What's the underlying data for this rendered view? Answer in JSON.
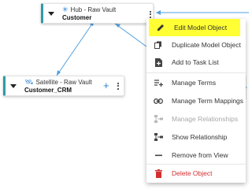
{
  "colors": {
    "accent": "#2f9aa7",
    "link_line": "#4f9fe0",
    "highlight": "#ffff33",
    "danger": "#d32f2f",
    "disabled": "#a8a8a8"
  },
  "hub_node": {
    "type_label": "Hub - Raw Vault",
    "type_icon": "hub-asterisk-icon",
    "name": "Customer"
  },
  "satellite_node": {
    "type_label": "Satellite - Raw Vault",
    "type_icon": "satellite-icon",
    "name": "Customer_CRM",
    "add_symbol": "+"
  },
  "context_menu": {
    "items": [
      {
        "label": "Edit Model Object",
        "icon": "pencil-icon",
        "state": "highlighted"
      },
      {
        "label": "Duplicate Model Object",
        "icon": "copy-icon",
        "state": "normal"
      },
      {
        "label": "Add to Task List",
        "icon": "add-file-icon",
        "state": "normal"
      },
      {
        "label": "Manage Terms",
        "icon": "playlist-add-icon",
        "state": "normal"
      },
      {
        "label": "Manage Term Mappings",
        "icon": "link-icon",
        "state": "normal"
      },
      {
        "label": "Manage Relationships",
        "icon": "relationships-icon",
        "state": "disabled"
      },
      {
        "label": "Show Relationship",
        "icon": "show-relationship-icon",
        "state": "normal"
      },
      {
        "label": "Remove from View",
        "icon": "minus-icon",
        "state": "normal"
      },
      {
        "label": "Delete Object",
        "icon": "trash-icon",
        "state": "danger"
      }
    ]
  }
}
